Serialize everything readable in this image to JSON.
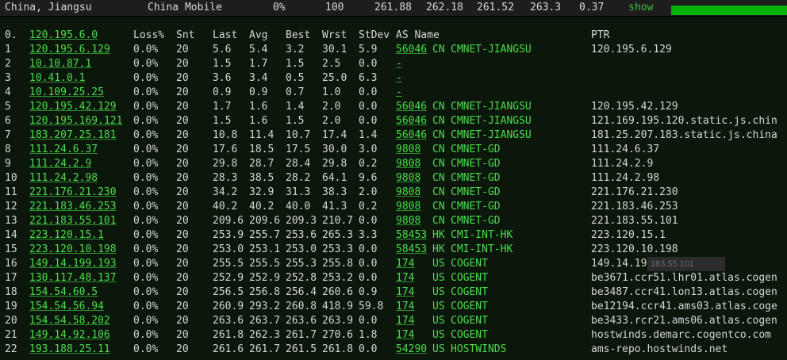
{
  "header": {
    "location": "China, Jiangsu",
    "isp": "China Mobile",
    "loss": "0%",
    "sent": "100",
    "last": "261.88",
    "avg": "262.18",
    "best": "261.52",
    "worst": "263.3",
    "stdev": "0.37",
    "show_label": "show",
    "progress": 1.0
  },
  "columns": {
    "num": "0.",
    "host": "120.195.6.0",
    "loss": "Loss%",
    "snt": "Snt",
    "last": "Last",
    "avg": "Avg",
    "best": "Best",
    "wrst": "Wrst",
    "stdev": "StDev",
    "asname": "AS Name",
    "ptr": "PTR"
  },
  "hops": [
    {
      "n": "1",
      "host": "120.195.6.129",
      "loss": "0.0%",
      "snt": "20",
      "last": "5.6",
      "avg": "5.4",
      "best": "3.2",
      "wrst": "30.1",
      "stdev": "5.9",
      "asn": "56046",
      "cc": "CN",
      "asname": "CMNET-JIANGSU",
      "ptr": "120.195.6.129"
    },
    {
      "n": "2",
      "host": "10.10.87.1",
      "loss": "0.0%",
      "snt": "20",
      "last": "1.5",
      "avg": "1.7",
      "best": "1.5",
      "wrst": "2.5",
      "stdev": "0.0",
      "asn": "-",
      "cc": "",
      "asname": "",
      "ptr": ""
    },
    {
      "n": "3",
      "host": "10.41.0.1",
      "loss": "0.0%",
      "snt": "20",
      "last": "3.6",
      "avg": "3.4",
      "best": "0.5",
      "wrst": "25.0",
      "stdev": "6.3",
      "asn": "-",
      "cc": "",
      "asname": "",
      "ptr": ""
    },
    {
      "n": "4",
      "host": "10.109.25.25",
      "loss": "0.0%",
      "snt": "20",
      "last": "0.9",
      "avg": "0.9",
      "best": "0.7",
      "wrst": "1.0",
      "stdev": "0.0",
      "asn": "-",
      "cc": "",
      "asname": "",
      "ptr": ""
    },
    {
      "n": "5",
      "host": "120.195.42.129",
      "loss": "0.0%",
      "snt": "20",
      "last": "1.7",
      "avg": "1.6",
      "best": "1.4",
      "wrst": "2.0",
      "stdev": "0.0",
      "asn": "56046",
      "cc": "CN",
      "asname": "CMNET-JIANGSU",
      "ptr": "120.195.42.129"
    },
    {
      "n": "6",
      "host": "120.195.169.121",
      "loss": "0.0%",
      "snt": "20",
      "last": "1.5",
      "avg": "1.6",
      "best": "1.5",
      "wrst": "2.0",
      "stdev": "0.0",
      "asn": "56046",
      "cc": "CN",
      "asname": "CMNET-JIANGSU",
      "ptr": "121.169.195.120.static.js.chin"
    },
    {
      "n": "7",
      "host": "183.207.25.181",
      "loss": "0.0%",
      "snt": "20",
      "last": "10.8",
      "avg": "11.4",
      "best": "10.7",
      "wrst": "17.4",
      "stdev": "1.4",
      "asn": "56046",
      "cc": "CN",
      "asname": "CMNET-JIANGSU",
      "ptr": "181.25.207.183.static.js.china"
    },
    {
      "n": "8",
      "host": "111.24.6.37",
      "loss": "0.0%",
      "snt": "20",
      "last": "17.6",
      "avg": "18.5",
      "best": "17.5",
      "wrst": "30.0",
      "stdev": "3.0",
      "asn": "9808",
      "cc": "CN",
      "asname": "CMNET-GD",
      "ptr": "111.24.6.37"
    },
    {
      "n": "9",
      "host": "111.24.2.9",
      "loss": "0.0%",
      "snt": "20",
      "last": "29.8",
      "avg": "28.7",
      "best": "28.4",
      "wrst": "29.8",
      "stdev": "0.2",
      "asn": "9808",
      "cc": "CN",
      "asname": "CMNET-GD",
      "ptr": "111.24.2.9"
    },
    {
      "n": "10",
      "host": "111.24.2.98",
      "loss": "0.0%",
      "snt": "20",
      "last": "28.3",
      "avg": "38.5",
      "best": "28.2",
      "wrst": "64.1",
      "stdev": "9.6",
      "asn": "9808",
      "cc": "CN",
      "asname": "CMNET-GD",
      "ptr": "111.24.2.98"
    },
    {
      "n": "11",
      "host": "221.176.21.230",
      "loss": "0.0%",
      "snt": "20",
      "last": "34.2",
      "avg": "32.9",
      "best": "31.3",
      "wrst": "38.3",
      "stdev": "2.0",
      "asn": "9808",
      "cc": "CN",
      "asname": "CMNET-GD",
      "ptr": "221.176.21.230"
    },
    {
      "n": "12",
      "host": "221.183.46.253",
      "loss": "0.0%",
      "snt": "20",
      "last": "40.2",
      "avg": "40.2",
      "best": "40.0",
      "wrst": "41.3",
      "stdev": "0.2",
      "asn": "9808",
      "cc": "CN",
      "asname": "CMNET-GD",
      "ptr": "221.183.46.253"
    },
    {
      "n": "13",
      "host": "221.183.55.101",
      "loss": "0.0%",
      "snt": "20",
      "last": "209.6",
      "avg": "209.6",
      "best": "209.3",
      "wrst": "210.7",
      "stdev": "0.0",
      "asn": "9808",
      "cc": "CN",
      "asname": "CMNET-GD",
      "ptr": "221.183.55.101"
    },
    {
      "n": "14",
      "host": "223.120.15.1",
      "loss": "0.0%",
      "snt": "20",
      "last": "253.9",
      "avg": "255.7",
      "best": "253.6",
      "wrst": "265.3",
      "stdev": "3.3",
      "asn": "58453",
      "cc": "HK",
      "asname": "CMI-INT-HK",
      "ptr": "223.120.15.1"
    },
    {
      "n": "15",
      "host": "223.120.10.198",
      "loss": "0.0%",
      "snt": "20",
      "last": "253.0",
      "avg": "253.1",
      "best": "253.0",
      "wrst": "253.3",
      "stdev": "0.0",
      "asn": "58453",
      "cc": "HK",
      "asname": "CMI-INT-HK",
      "ptr": "223.120.10.198"
    },
    {
      "n": "16",
      "host": "149.14.199.193",
      "loss": "0.0%",
      "snt": "20",
      "last": "255.5",
      "avg": "255.5",
      "best": "255.3",
      "wrst": "255.8",
      "stdev": "0.0",
      "asn": "174",
      "cc": "US",
      "asname": "COGENT",
      "ptr": "149.14.199.193"
    },
    {
      "n": "17",
      "host": "130.117.48.137",
      "loss": "0.0%",
      "snt": "20",
      "last": "252.9",
      "avg": "252.9",
      "best": "252.8",
      "wrst": "253.2",
      "stdev": "0.0",
      "asn": "174",
      "cc": "US",
      "asname": "COGENT",
      "ptr": "be3671.ccr51.lhr01.atlas.cogen"
    },
    {
      "n": "18",
      "host": "154.54.60.5",
      "loss": "0.0%",
      "snt": "20",
      "last": "256.5",
      "avg": "256.8",
      "best": "256.4",
      "wrst": "260.6",
      "stdev": "0.9",
      "asn": "174",
      "cc": "US",
      "asname": "COGENT",
      "ptr": "be3487.ccr41.lon13.atlas.cogen"
    },
    {
      "n": "19",
      "host": "154.54.56.94",
      "loss": "0.0%",
      "snt": "20",
      "last": "260.9",
      "avg": "293.2",
      "best": "260.8",
      "wrst": "418.9",
      "stdev": "59.8",
      "asn": "174",
      "cc": "US",
      "asname": "COGENT",
      "ptr": "be12194.ccr41.ams03.atlas.coge"
    },
    {
      "n": "20",
      "host": "154.54.58.202",
      "loss": "0.0%",
      "snt": "20",
      "last": "263.6",
      "avg": "263.7",
      "best": "263.6",
      "wrst": "263.9",
      "stdev": "0.0",
      "asn": "174",
      "cc": "US",
      "asname": "COGENT",
      "ptr": "be3433.rcr21.ams06.atlas.cogen"
    },
    {
      "n": "21",
      "host": "149.14.92.106",
      "loss": "0.0%",
      "snt": "20",
      "last": "261.8",
      "avg": "262.3",
      "best": "261.7",
      "wrst": "270.6",
      "stdev": "1.8",
      "asn": "174",
      "cc": "US",
      "asname": "COGENT",
      "ptr": "hostwinds.demarc.cogentco.com"
    },
    {
      "n": "22",
      "host": "193.188.25.11",
      "loss": "0.0%",
      "snt": "20",
      "last": "261.6",
      "avg": "261.7",
      "best": "261.5",
      "wrst": "261.8",
      "stdev": "0.0",
      "asn": "54290",
      "cc": "US",
      "asname": "HOSTWINDS",
      "ptr": "ams-repo.hostwinds.net"
    }
  ],
  "tooltip": "183.55.101"
}
